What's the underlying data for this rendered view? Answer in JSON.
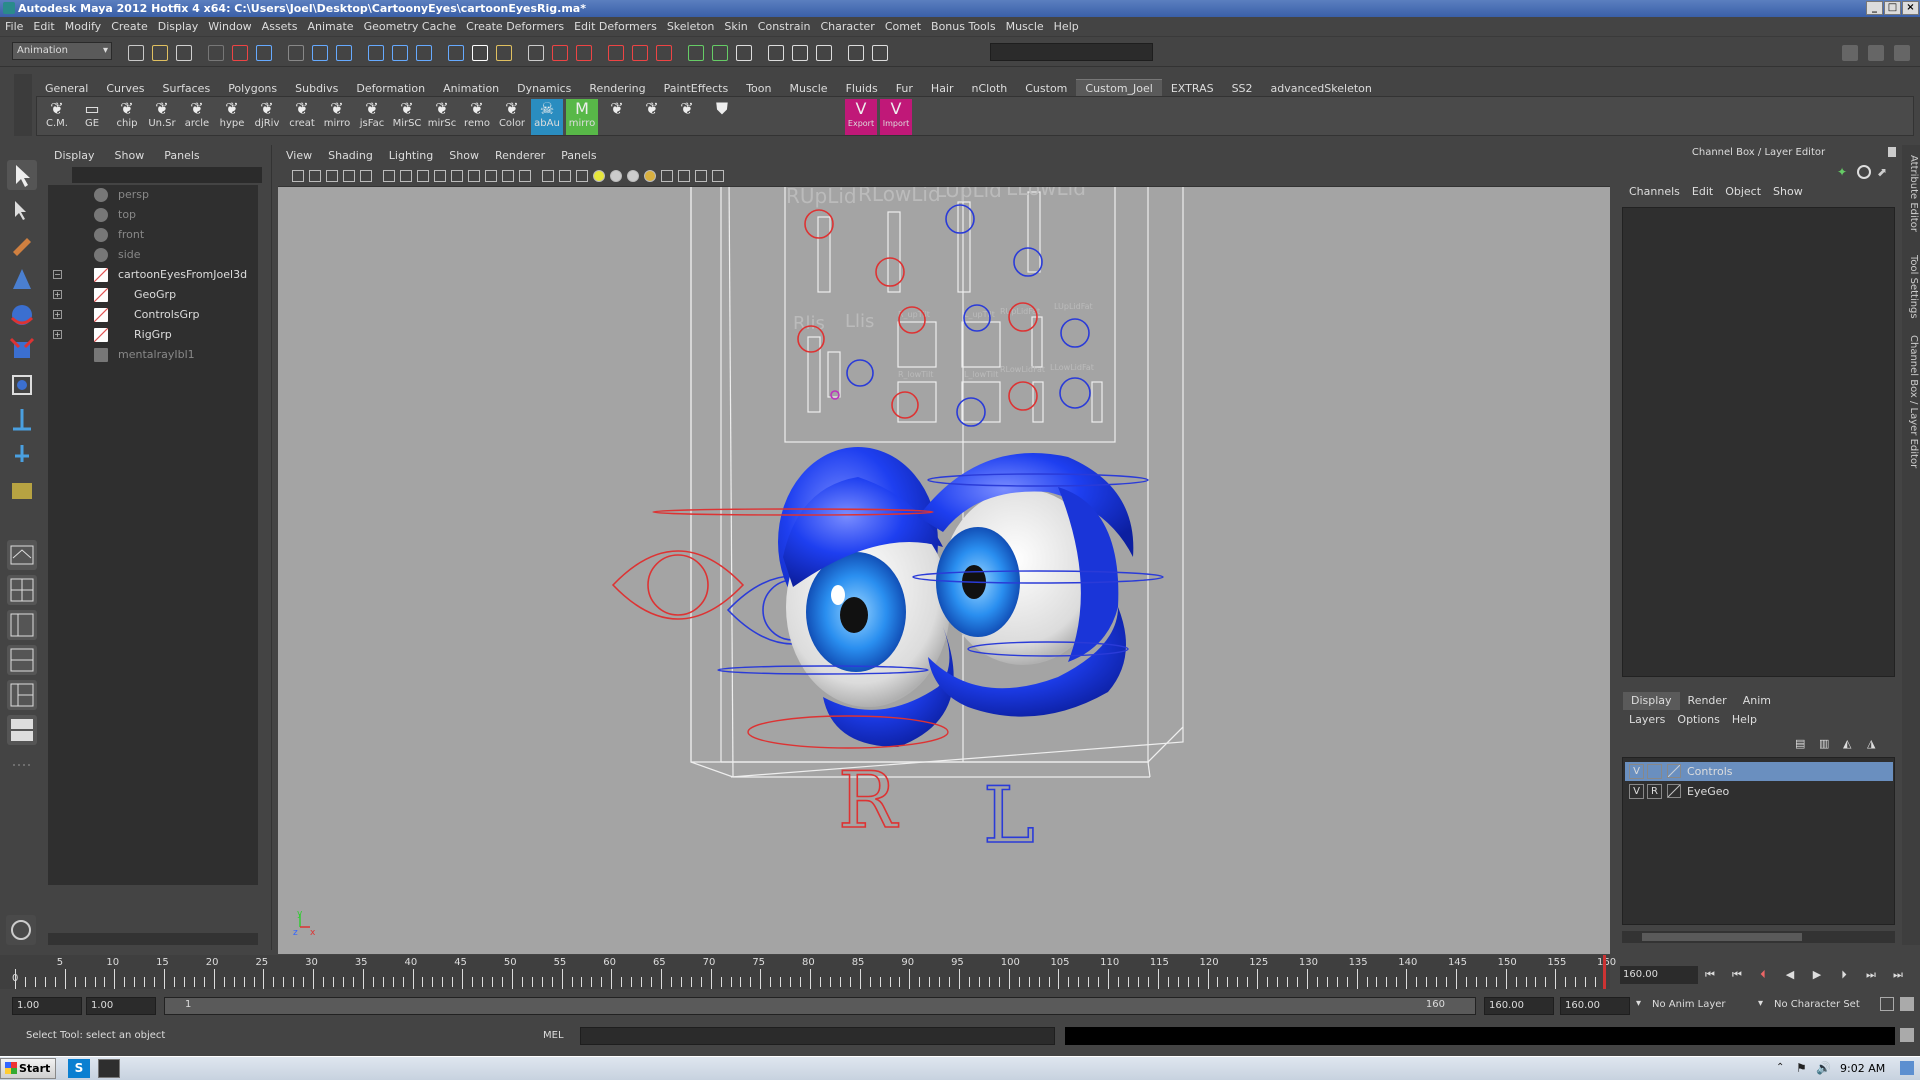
{
  "window": {
    "title": "Autodesk Maya 2012 Hotfix 4 x64: C:\\Users\\Joel\\Desktop\\CartoonyEyes\\cartoonEyesRig.ma*"
  },
  "menubar": [
    "File",
    "Edit",
    "Modify",
    "Create",
    "Display",
    "Window",
    "Assets",
    "Animate",
    "Geometry Cache",
    "Create Deformers",
    "Edit Deformers",
    "Skeleton",
    "Skin",
    "Constrain",
    "Character",
    "Comet",
    "Bonus Tools",
    "Muscle",
    "Help"
  ],
  "statusline": {
    "mode": "Animation"
  },
  "shelf": {
    "tabs": [
      "General",
      "Curves",
      "Surfaces",
      "Polygons",
      "Subdivs",
      "Deformation",
      "Animation",
      "Dynamics",
      "Rendering",
      "PaintEffects",
      "Toon",
      "Muscle",
      "Fluids",
      "Fur",
      "Hair",
      "nCloth",
      "Custom",
      "Custom_Joel",
      "EXTRAS",
      "SS2",
      "advancedSkeleton"
    ],
    "active_tab": "Custom_Joel",
    "buttons": [
      "C.M.",
      "GE",
      "chip",
      "Un.Sr",
      "arcle",
      "hype",
      "djRiv",
      "creat",
      "mirro",
      "jsFac",
      "MirSC",
      "mirSc",
      "remo",
      "Color",
      "abAu",
      "mirro"
    ],
    "special_buttons": [
      {
        "label": "Export"
      },
      {
        "label": "Import"
      }
    ]
  },
  "outliner": {
    "menu": [
      "Display",
      "Show",
      "Panels"
    ],
    "items": [
      {
        "label": "persp",
        "dim": true,
        "indent": 0
      },
      {
        "label": "top",
        "dim": true,
        "indent": 0
      },
      {
        "label": "front",
        "dim": true,
        "indent": 0
      },
      {
        "label": "side",
        "dim": true,
        "indent": 0
      },
      {
        "label": "cartoonEyesFromJoel3d",
        "dim": false,
        "indent": 0,
        "expand": "−"
      },
      {
        "label": "GeoGrp",
        "dim": false,
        "indent": 1,
        "expand": "+"
      },
      {
        "label": "ControlsGrp",
        "dim": false,
        "indent": 1,
        "expand": "+"
      },
      {
        "label": "RigGrp",
        "dim": false,
        "indent": 1,
        "expand": "+"
      },
      {
        "label": "mentalrayIbl1",
        "dim": true,
        "indent": 0
      }
    ]
  },
  "viewport": {
    "menu": [
      "View",
      "Shading",
      "Lighting",
      "Show",
      "Renderer",
      "Panels"
    ],
    "labels": {
      "rupl": "RUpLid",
      "rlowl": "RLowLid",
      "lupl": "LUpLid",
      "llowl": "LLowLid",
      "rlis": "Rlis",
      "llis": "Llis",
      "rupfat": "R_upTilt",
      "lupfat": "L_upTilt",
      "rupfatlid": "RUpLidFat",
      "lupfatlid": "LUpLidFat",
      "rlowtilt": "R_lowTilt",
      "llowtilt": "L_lowTilt",
      "rlowfat": "RLowLidFat",
      "llowfat": "LLowLidFat",
      "r": "R",
      "l": "L"
    },
    "axis": {
      "y": "y",
      "z": "z",
      "x": "x"
    }
  },
  "channelbox": {
    "title": "Channel Box / Layer Editor",
    "menu": [
      "Channels",
      "Edit",
      "Object",
      "Show"
    ]
  },
  "layers": {
    "tabs": [
      "Display",
      "Render",
      "Anim"
    ],
    "active_tab": "Display",
    "menu": [
      "Layers",
      "Options",
      "Help"
    ],
    "rows": [
      {
        "v": "V",
        "r": "",
        "name": "Controls",
        "selected": true
      },
      {
        "v": "V",
        "r": "R",
        "name": "EyeGeo",
        "selected": false
      }
    ]
  },
  "sidetabs": [
    "Attribute Editor",
    "Tool Settings",
    "Channel Box / Layer Editor"
  ],
  "timeline": {
    "ticks": [
      5,
      10,
      15,
      20,
      25,
      30,
      35,
      40,
      45,
      50,
      55,
      60,
      65,
      70,
      75,
      80,
      85,
      90,
      95,
      100,
      105,
      110,
      115,
      120,
      125,
      130,
      135,
      140,
      145,
      150,
      155,
      160
    ],
    "current_frame": "160.00",
    "first_label": "0"
  },
  "range": {
    "start": "1.00",
    "start2": "1.00",
    "slider_start": "1",
    "slider_end": "160",
    "end": "160.00",
    "end2": "160.00",
    "anim_layer": "No Anim Layer",
    "char_set": "No Character Set"
  },
  "commandline": {
    "help": "Select Tool: select an object",
    "lang": "MEL"
  },
  "taskbar": {
    "start": "Start",
    "clock": "9:02 AM"
  }
}
